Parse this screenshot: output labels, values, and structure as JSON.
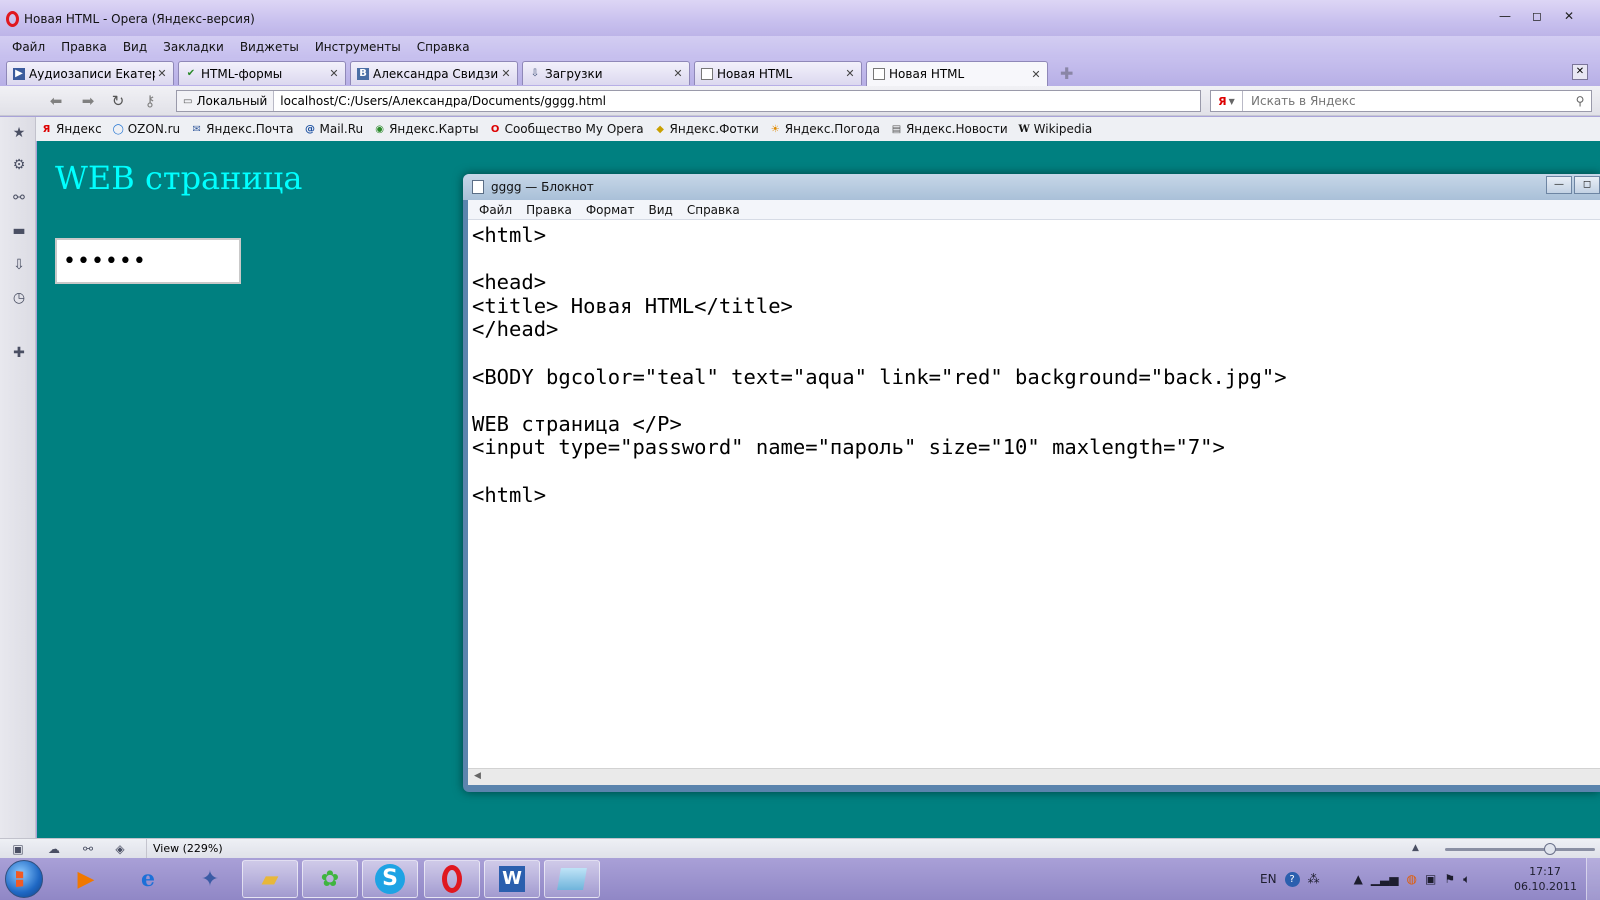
{
  "browser": {
    "title": "Новая HTML - Opera (Яндекс-версия)",
    "window_controls": {
      "minimize": "—",
      "maximize": "◻",
      "close": "✕"
    },
    "menu": [
      "Файл",
      "Правка",
      "Вид",
      "Закладки",
      "Виджеты",
      "Инструменты",
      "Справка"
    ],
    "tabs": [
      {
        "label": "Аудиозаписи Екатери...",
        "icon": "play-icon",
        "active": false
      },
      {
        "label": "HTML-формы",
        "icon": "check-icon",
        "active": false
      },
      {
        "label": "Александра Свидзинс...",
        "icon": "vk-icon",
        "active": false
      },
      {
        "label": "Загрузки",
        "icon": "download-icon",
        "active": false
      },
      {
        "label": "Новая HTML",
        "icon": "page-icon",
        "active": false
      },
      {
        "label": "Новая HTML",
        "icon": "page-icon",
        "active": true
      }
    ],
    "address": {
      "security_label": "Локальный",
      "url": "localhost/C:/Users/Александра/Documents/gggg.html"
    },
    "search": {
      "engine": "Я",
      "placeholder": "Искать в Яндекс"
    },
    "bookmarks": [
      {
        "label": "Яндекс",
        "icon": "yandex-icon"
      },
      {
        "label": "OZON.ru",
        "icon": "ozon-icon"
      },
      {
        "label": "Яндекс.Почта",
        "icon": "mail-icon"
      },
      {
        "label": "Mail.Ru",
        "icon": "at-icon"
      },
      {
        "label": "Яндекс.Карты",
        "icon": "map-icon"
      },
      {
        "label": "Сообщество My Opera",
        "icon": "opera-icon"
      },
      {
        "label": "Яндекс.Фотки",
        "icon": "photo-icon"
      },
      {
        "label": "Яндекс.Погода",
        "icon": "weather-icon"
      },
      {
        "label": "Яндекс.Новости",
        "icon": "news-icon"
      },
      {
        "label": "Wikipedia",
        "icon": "wikipedia-icon"
      }
    ],
    "status": {
      "view": "View (229%)",
      "zoom_level": 0.72
    }
  },
  "page": {
    "heading": "WEB страница",
    "password_value": "••••••",
    "colors": {
      "background": "#008080",
      "text": "#00ffff"
    }
  },
  "notepad": {
    "title": "gggg — Блокнот",
    "menu": [
      "Файл",
      "Правка",
      "Формат",
      "Вид",
      "Справка"
    ],
    "content": "<html>\n\n<head>\n<title> Новая HTML</title>\n</head>\n\n<BODY bgcolor=\"teal\" text=\"aqua\" link=\"red\" background=\"back.jpg\">\n\nWEB страница </P>\n<input type=\"password\" name=\"пароль\" size=\"10\" maxlength=\"7\">\n\n<html>"
  },
  "taskbar": {
    "apps": [
      {
        "name": "media-player-icon",
        "open": false
      },
      {
        "name": "internet-explorer-icon",
        "open": false
      },
      {
        "name": "wizard-icon",
        "open": false
      },
      {
        "name": "explorer-folder-icon",
        "open": true
      },
      {
        "name": "icq-icon",
        "open": true
      },
      {
        "name": "skype-icon",
        "open": true
      },
      {
        "name": "opera-icon",
        "open": true
      },
      {
        "name": "word-icon",
        "open": true
      },
      {
        "name": "notepad-icon",
        "open": true
      }
    ],
    "language": "EN",
    "time": "17:17",
    "date": "06.10.2011"
  }
}
